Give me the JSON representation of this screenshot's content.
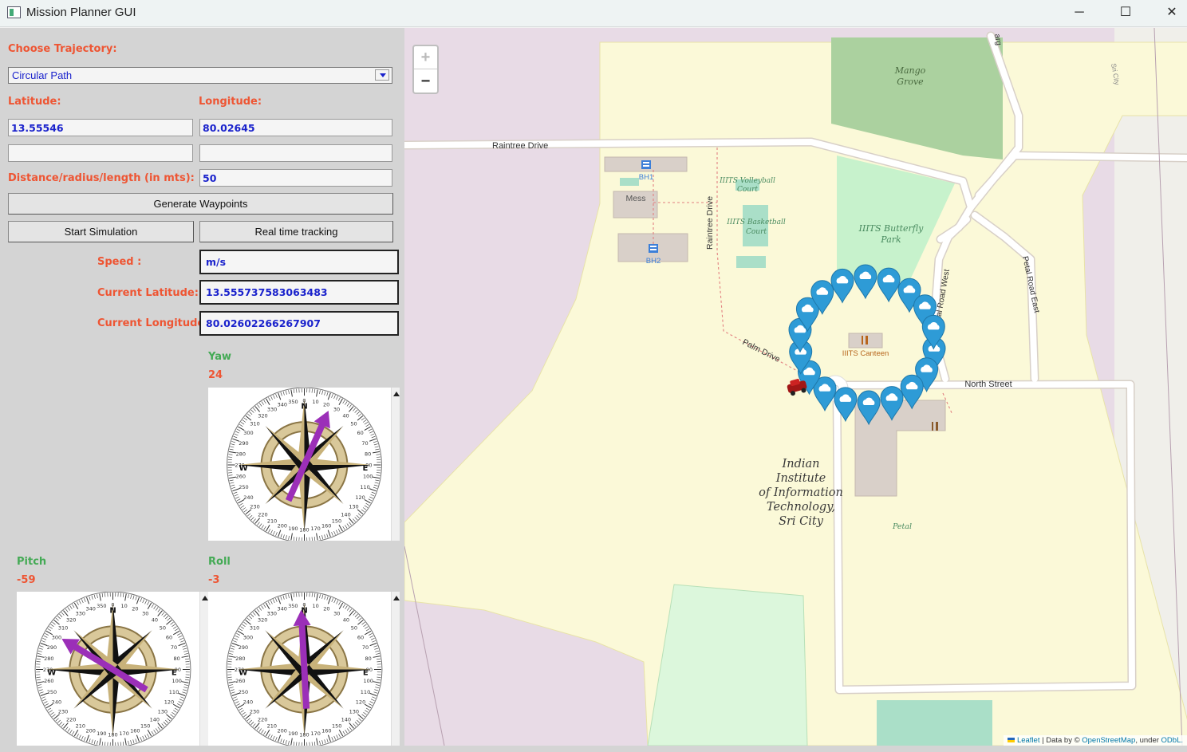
{
  "window": {
    "title": "Mission Planner GUI",
    "minimize": "─",
    "maximize": "☐",
    "close": "✕"
  },
  "controls": {
    "choose_trajectory_label": "Choose Trajectory:",
    "trajectory_selected": "Circular Path",
    "latitude_label": "Latitude:",
    "longitude_label": "Longitude:",
    "latitude_value": "13.55546",
    "longitude_value": "80.02645",
    "latitude_value_2": "",
    "longitude_value_2": "",
    "distance_label": "Distance/radius/length (in mts):",
    "distance_value": "50",
    "generate_button": "Generate Waypoints",
    "start_sim_button": "Start Simulation",
    "realtime_button": "Real time tracking"
  },
  "telemetry": {
    "speed_label": "Speed :",
    "speed_value": "m/s",
    "cur_lat_label": "Current Latitude:",
    "cur_lat_value": "13.555737583063483",
    "cur_lon_label": "Current Longitude:",
    "cur_lon_value": "80.02602266267907"
  },
  "gauges": {
    "yaw_label": "Yaw",
    "yaw_value": "24",
    "pitch_label": "Pitch",
    "pitch_value": "-59",
    "roll_label": "Roll",
    "roll_value": "-3"
  },
  "map": {
    "zoom_in": "+",
    "zoom_out": "−",
    "attribution_leaflet": "Leaflet",
    "attribution_mid": " | Data by © ",
    "attribution_osm": "OpenStreetMap",
    "attribution_under": ", under ",
    "attribution_odbl": "ODbL.",
    "labels": {
      "raintree_drive": "Raintree Drive",
      "raintree_drive_v": "Raintree Drive",
      "bh1": "BH1",
      "bh2": "BH2",
      "mess": "Mess",
      "volleyball_1": "IIITS Volleyball",
      "volleyball_2": "Court",
      "basketball_1": "IIITS Basketball",
      "basketball_2": "Court",
      "butterfly_1": "IIITS Butterfly",
      "butterfly_2": "Park",
      "mango_1": "Mango",
      "mango_2": "Grove",
      "canteen": "IIITS Canteen",
      "palm_drive": "Palm Drive",
      "north_street": "North Street",
      "petal_west": "Petal Road West",
      "petal_east": "Petal Road East",
      "petal": "Petal",
      "sri_city": "Sri City",
      "marg": "arg",
      "iiit_1": "Indian",
      "iiit_2": "Institute",
      "iiit_3": "of Information",
      "iiit_4": "Technology,",
      "iiit_5": "Sri City"
    }
  },
  "colors": {
    "label_red": "#ee5533",
    "label_green": "#44aa55",
    "value_blue": "#1a22cc",
    "marker_blue": "#2e9bd6",
    "arrow_purple": "#9b2fb8"
  }
}
